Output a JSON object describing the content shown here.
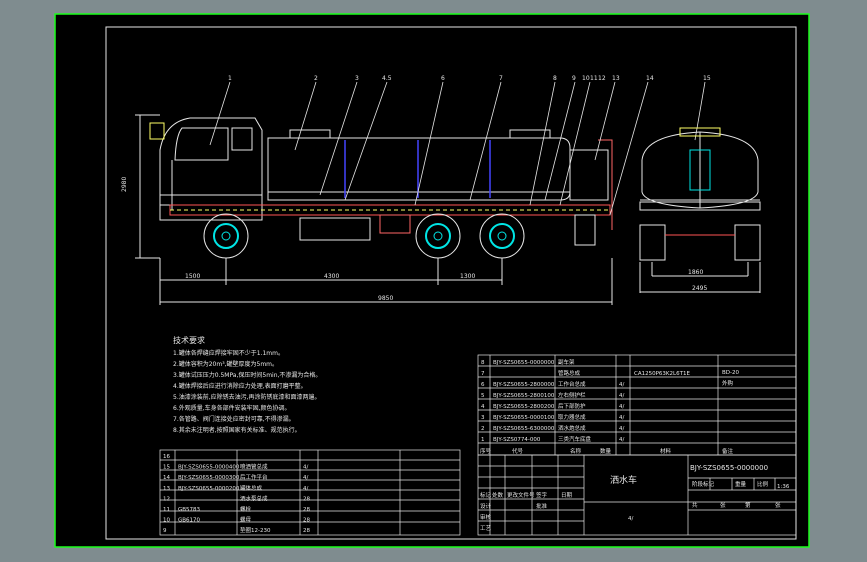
{
  "callouts": [
    "1",
    "2",
    "3",
    "4.5",
    "6",
    "7",
    "8",
    "9",
    "10",
    "11",
    "12",
    "13",
    "14",
    "15"
  ],
  "dimensions": {
    "height": "2980",
    "front": "1500",
    "wheelbase1": "4300",
    "wheelbase2": "1300",
    "overall": "9850",
    "rear_track": "1860",
    "rear_width": "2495"
  },
  "notes": {
    "title": "技术要求",
    "lines": [
      "1.罐体各焊缝应焊接牢固不少于1.1mm。",
      "2.罐体容积为20m³,罐壁厚度为5mm。",
      "3.罐体试压压力0.5MPa,保压时间5min,不渗漏为合格。",
      "4.罐体焊接后应进行消除应力处理,表面打磨平整。",
      "5.油漆涂装前,应除锈去油污,再涂防锈底漆和面漆两遍。",
      "6.外观质量,车身各部件安装牢固,颜色协调。",
      "7.各管路、阀门连接处应密封可靠,不得渗漏。",
      "8.其余未注明者,按照国家有关标准、规范执行。"
    ]
  },
  "title_block": {
    "left_rows": [
      {
        "no": "16",
        "code": "",
        "name": "",
        "qty": "",
        "mat": ""
      },
      {
        "no": "15",
        "code": "BJY-SZS0655-0000400",
        "name": "喷洒管总成",
        "qty": "4/",
        "mat": ""
      },
      {
        "no": "14",
        "code": "BJY-SZS0655-0000300",
        "name": "后工作平台",
        "qty": "4/",
        "mat": ""
      },
      {
        "no": "13",
        "code": "BJY-SZS0655-0000200",
        "name": "罐体总成",
        "qty": "4/",
        "mat": ""
      },
      {
        "no": "12",
        "code": "",
        "name": "洒水泵总成",
        "qty": "28",
        "mat": ""
      },
      {
        "no": "11",
        "code": "GB5783",
        "name": "螺栓",
        "qty": "28",
        "mat": ""
      },
      {
        "no": "10",
        "code": "GB6170",
        "name": "螺母",
        "qty": "28",
        "mat": ""
      },
      {
        "no": "9",
        "code": "",
        "name": "垫圈12-230",
        "qty": "28",
        "mat": ""
      }
    ],
    "right_rows": [
      {
        "no": "8",
        "code": "BJY-SZS0655-0000000",
        "name": "副车架",
        "qty": "",
        "mat": "",
        "extra": ""
      },
      {
        "no": "7",
        "code": "",
        "name": "管路总成",
        "qty": "",
        "mat": "",
        "extra": "CA1250P63K2L6T1E"
      },
      {
        "no": "6",
        "code": "BJY-SZS0655-2800000",
        "name": "工作台总成",
        "qty": "4/",
        "mat": "",
        "extra": ""
      },
      {
        "no": "5",
        "code": "BJY-SZS0655-2800100",
        "name": "左右侧护栏",
        "qty": "4/",
        "mat": "",
        "extra": ""
      },
      {
        "no": "4",
        "code": "BJY-SZS0655-2800200",
        "name": "后下部防护",
        "qty": "4/",
        "mat": "",
        "extra": ""
      },
      {
        "no": "3",
        "code": "BJY-SZS0655-0000100",
        "name": "取力器总成",
        "qty": "4/",
        "mat": "",
        "extra": ""
      },
      {
        "no": "2",
        "code": "BJY-SZS0655-6300000",
        "name": "洒水炮总成",
        "qty": "4/",
        "mat": "",
        "extra": ""
      },
      {
        "no": "1",
        "code": "BJY-SZS0774-000",
        "name": "三类汽车底盘",
        "qty": "4/",
        "mat": "",
        "extra": ""
      }
    ],
    "header": {
      "no": "序号",
      "code": "代号",
      "name": "名称",
      "qty": "数量",
      "mat": "材料",
      "note": "备注"
    },
    "side_labels": {
      "chassis": "BD-20",
      "weight": "外购"
    },
    "product_name": "洒水车",
    "drawing_no": "BJY-SZS0655-0000000",
    "scale": "1:36",
    "sheet": "4/",
    "sign_labels": [
      "标记",
      "处数",
      "更改文件号",
      "签字",
      "日期",
      "设计",
      "审核",
      "工艺",
      "批准"
    ],
    "stage_labels": [
      "阶段标记",
      "重量",
      "比例"
    ],
    "sheet_labels": [
      "共",
      "张",
      "第",
      "张"
    ]
  }
}
